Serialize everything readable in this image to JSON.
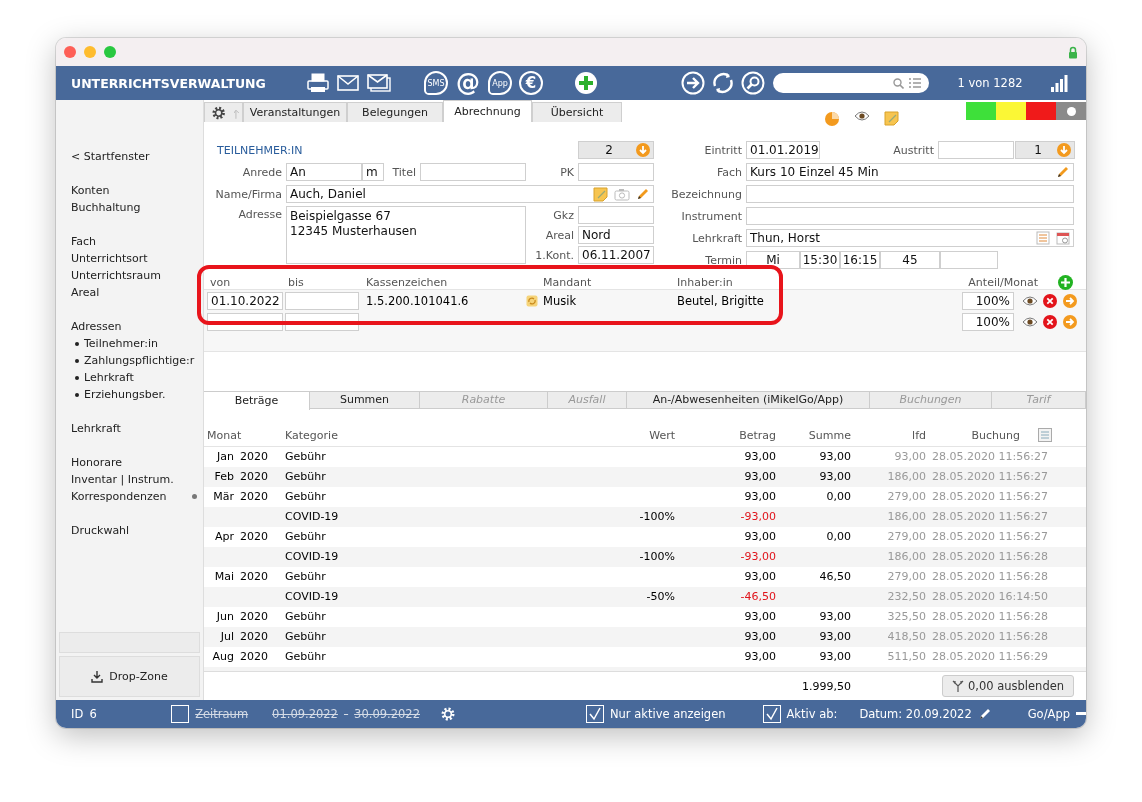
{
  "toolbar": {
    "app_title": "UNTERRICHTSVERWALTUNG",
    "badges": [
      {
        "label": "SMS",
        "kind": "bubble"
      },
      {
        "label": "@",
        "kind": "plain"
      },
      {
        "label": "App",
        "kind": "bubble"
      },
      {
        "label": "€",
        "kind": "ring"
      }
    ],
    "record_counter": "1 von 1282"
  },
  "sidebar": {
    "groups": [
      [
        {
          "label": "< Startfenster",
          "marked": false
        }
      ],
      [
        {
          "label": "Konten",
          "marked": false
        },
        {
          "label": "Buchhaltung",
          "marked": false
        }
      ],
      [
        {
          "label": "Fach",
          "marked": false
        },
        {
          "label": "Unterrichtsort",
          "marked": false
        },
        {
          "label": "Unterrichtsraum",
          "marked": false
        },
        {
          "label": "Areal",
          "marked": false
        }
      ],
      [
        {
          "label": "Adressen",
          "marked": false,
          "children": [
            {
              "label": "Teilnehmer:in"
            },
            {
              "label": "Zahlungspflichtige:r"
            },
            {
              "label": "Lehrkraft"
            },
            {
              "label": "Erziehungsber."
            }
          ]
        }
      ],
      [
        {
          "label": "Lehrkraft",
          "marked": false
        }
      ],
      [
        {
          "label": "Honorare",
          "marked": false
        },
        {
          "label": "Inventar | Instrum.",
          "marked": false
        },
        {
          "label": "Korrespondenzen",
          "marked": true
        }
      ],
      [
        {
          "label": "Druckwahl",
          "marked": false
        }
      ]
    ],
    "drop_zone": "Drop-Zone"
  },
  "record_tabs": [
    {
      "label": "Veranstaltungen",
      "selected": false
    },
    {
      "label": "Belegungen",
      "selected": false
    },
    {
      "label": "Abrechnung",
      "selected": true
    },
    {
      "label": "Übersicht",
      "selected": false
    }
  ],
  "status_colors": [
    {
      "color": "#3ee03a",
      "selected": false
    },
    {
      "color": "#fbf735",
      "selected": false
    },
    {
      "color": "#f01a1a",
      "selected": false
    },
    {
      "color": "#8a8a8a",
      "selected": true
    }
  ],
  "participant": {
    "title": "TEILNEHMER:IN",
    "counter": "2",
    "salutation": {
      "label": "Anrede",
      "value": "An"
    },
    "gender": {
      "value": "m"
    },
    "title_field": {
      "label": "Titel"
    },
    "pk": {
      "label": "PK"
    },
    "name": {
      "label": "Name/Firma",
      "value": "Auch, Daniel"
    },
    "address": {
      "label": "Adresse",
      "lines": [
        "Beispielgasse 67",
        "12345 Musterhausen"
      ]
    },
    "gkz": {
      "label": "Gkz"
    },
    "areal": {
      "label": "Areal",
      "value": "Nord"
    },
    "first_contact": {
      "label": "1.Kont.",
      "value": "06.11.2007"
    }
  },
  "course": {
    "entry": {
      "label": "Eintritt",
      "value": "01.01.2019"
    },
    "exit": {
      "label": "Austritt"
    },
    "counter": "1",
    "subject": {
      "label": "Fach",
      "value": "Kurs 10 Einzel 45 Min"
    },
    "designation": {
      "label": "Bezeichnung"
    },
    "instrument": {
      "label": "Instrument"
    },
    "teacher": {
      "label": "Lehrkraft",
      "value": "Thun, Horst"
    },
    "schedule": {
      "label": "Termin",
      "cells": [
        "Mi",
        "15:30",
        "16:15",
        "45"
      ]
    }
  },
  "membership": {
    "columns": [
      "von",
      "bis",
      "Kassenzeichen",
      "Mandant",
      "Inhaber:in",
      "Anteil/Monat"
    ],
    "rows": [
      {
        "from": "01.10.2022",
        "cash_code": "1.5.200.101041.6",
        "client": "Musik",
        "holder": "Beutel, Brigitte",
        "share": "100%"
      },
      {
        "share": "100%"
      }
    ]
  },
  "detail_tabs": [
    {
      "label": "Beträge",
      "selected": true,
      "disabled": false
    },
    {
      "label": "Summen",
      "selected": false,
      "disabled": false
    },
    {
      "label": "Rabatte",
      "selected": false,
      "disabled": true
    },
    {
      "label": "Ausfall",
      "selected": false,
      "disabled": true
    },
    {
      "label": "An-/Abwesenheiten (iMikelGo/App)",
      "selected": false,
      "disabled": false
    },
    {
      "label": "Buchungen",
      "selected": false,
      "disabled": true
    },
    {
      "label": "Tarif",
      "selected": false,
      "disabled": true
    }
  ],
  "fees": {
    "columns": [
      "Monat",
      "Kategorie",
      "Wert",
      "Betrag",
      "Summe",
      "lfd",
      "Buchung"
    ],
    "rows": [
      {
        "month": "Jan",
        "year": "2020",
        "category": "Gebühr",
        "amount": "93,00",
        "negative": false,
        "sum": "93,00",
        "running": "93,00",
        "booking": "28.05.2020 11:56:27"
      },
      {
        "month": "Feb",
        "year": "2020",
        "category": "Gebühr",
        "amount": "93,00",
        "negative": false,
        "sum": "93,00",
        "running": "186,00",
        "booking": "28.05.2020 11:56:27"
      },
      {
        "month": "Mär",
        "year": "2020",
        "category": "Gebühr",
        "amount": "93,00",
        "negative": false,
        "sum": "0,00",
        "running": "279,00",
        "booking": "28.05.2020 11:56:27"
      },
      {
        "category": "COVID-19",
        "value": "-100%",
        "amount": "-93,00",
        "negative": true,
        "running": "186,00",
        "booking": "28.05.2020 11:56:27"
      },
      {
        "month": "Apr",
        "year": "2020",
        "category": "Gebühr",
        "amount": "93,00",
        "negative": false,
        "sum": "0,00",
        "running": "279,00",
        "booking": "28.05.2020 11:56:27"
      },
      {
        "category": "COVID-19",
        "value": "-100%",
        "amount": "-93,00",
        "negative": true,
        "running": "186,00",
        "booking": "28.05.2020 11:56:28"
      },
      {
        "month": "Mai",
        "year": "2020",
        "category": "Gebühr",
        "amount": "93,00",
        "negative": false,
        "sum": "46,50",
        "running": "279,00",
        "booking": "28.05.2020 11:56:28"
      },
      {
        "category": "COVID-19",
        "value": "-50%",
        "amount": "-46,50",
        "negative": true,
        "running": "232,50",
        "booking": "28.05.2020 16:14:50"
      },
      {
        "month": "Jun",
        "year": "2020",
        "category": "Gebühr",
        "amount": "93,00",
        "negative": false,
        "sum": "93,00",
        "running": "325,50",
        "booking": "28.05.2020 11:56:28"
      },
      {
        "month": "Jul",
        "year": "2020",
        "category": "Gebühr",
        "amount": "93,00",
        "negative": false,
        "sum": "93,00",
        "running": "418,50",
        "booking": "28.05.2020 11:56:28"
      },
      {
        "month": "Aug",
        "year": "2020",
        "category": "Gebühr",
        "amount": "93,00",
        "negative": false,
        "sum": "93,00",
        "running": "511,50",
        "booking": "28.05.2020 11:56:29"
      }
    ],
    "total": "1.999,50",
    "hide_button": "0,00 ausblenden"
  },
  "status_bar": {
    "id_label": "ID",
    "id": "6",
    "period": {
      "checked": false,
      "label": "Zeitraum",
      "from": "01.09.2022",
      "separator": "-",
      "to": "30.09.2022"
    },
    "active_only": {
      "checked": true,
      "label": "Nur aktive anzeigen"
    },
    "active_from": {
      "checked": true,
      "label": "Aktiv ab:"
    },
    "date": "Datum: 20.09.2022",
    "go_app": "Go/App"
  }
}
